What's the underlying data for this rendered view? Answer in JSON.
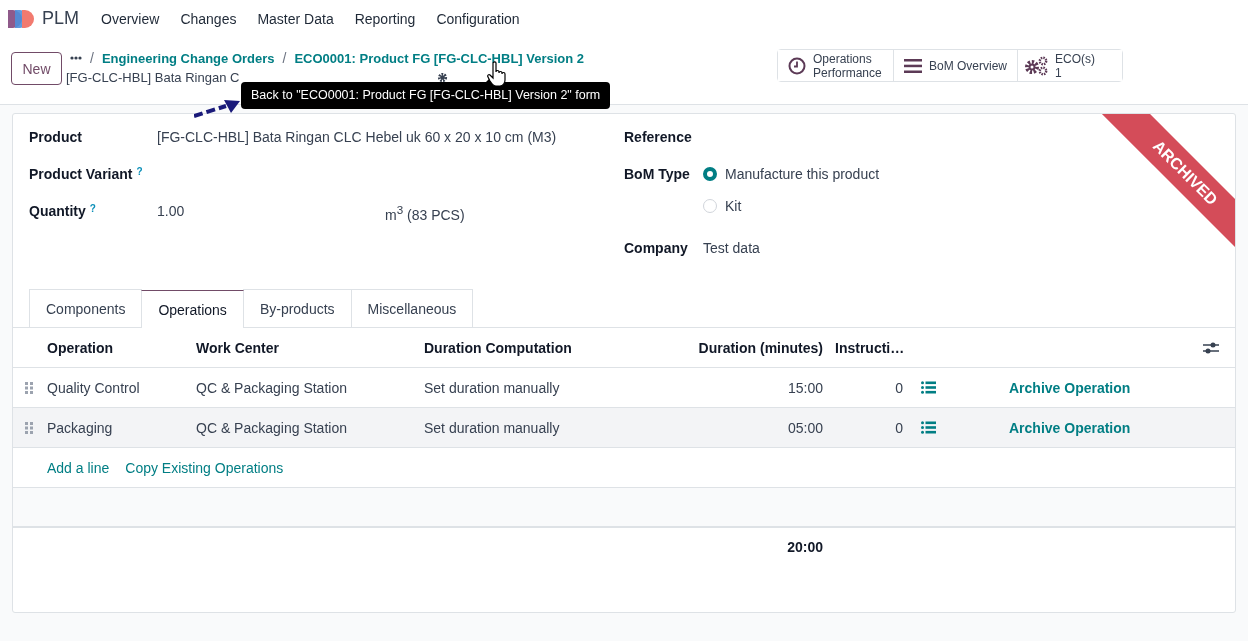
{
  "app": {
    "name": "PLM"
  },
  "menu": [
    {
      "label": "Overview"
    },
    {
      "label": "Changes"
    },
    {
      "label": "Master Data"
    },
    {
      "label": "Reporting"
    },
    {
      "label": "Configuration"
    }
  ],
  "control_panel": {
    "new_button": "New",
    "breadcrumbs": [
      {
        "separator": "/",
        "label": "Engineering Change Orders"
      },
      {
        "separator": "/",
        "label": "ECO0001: Product FG [FG-CLC-HBL] Version 2"
      }
    ],
    "record_title": "[FG-CLC-HBL] Bata Ringan C",
    "tooltip": "Back to \"ECO0001: Product FG [FG-CLC-HBL] Version 2\" form",
    "smart_buttons": [
      {
        "kind": "clock",
        "label": "Operations Performance"
      },
      {
        "kind": "list",
        "label": "BoM Overview"
      },
      {
        "kind": "gears",
        "label": "ECO(s)",
        "value": "1"
      }
    ]
  },
  "ribbon": "ARCHIVED",
  "fields_left": [
    {
      "label": "Product",
      "value": "[FG-CLC-HBL] Bata Ringan CLC Hebel uk 60 x 20 x 10 cm (M3)"
    },
    {
      "label": "Product Variant",
      "help": "?"
    },
    {
      "label": "Quantity",
      "help": "?",
      "value": "1.00",
      "unit": "m$^{3}$ (83 PCS)"
    }
  ],
  "fields_right": [
    {
      "label": "Reference"
    },
    {
      "label": "BoM Type",
      "options": [
        {
          "label": "Manufacture this product",
          "selected": true
        },
        {
          "label": "Kit",
          "selected": false
        }
      ]
    },
    {
      "label": "Company",
      "value": "Test data"
    }
  ],
  "tabs": [
    {
      "label": "Components",
      "selected": false
    },
    {
      "label": "Operations",
      "selected": true
    },
    {
      "label": "By-products",
      "selected": false
    },
    {
      "label": "Miscellaneous",
      "selected": false
    }
  ],
  "table": {
    "columns": [
      "Operation",
      "Work Center",
      "Duration Computation",
      "Duration (minutes)",
      "Instructi…"
    ],
    "rows": [
      {
        "operation": "Quality Control",
        "work_center": "QC & Packaging Station",
        "duration_computation": "Set duration manually",
        "duration": "15:00",
        "instructions": "0",
        "action": "Archive Operation",
        "hovered": false
      },
      {
        "operation": "Packaging",
        "work_center": "QC & Packaging Station",
        "duration_computation": "Set duration manually",
        "duration": "05:00",
        "instructions": "0",
        "action": "Archive Operation",
        "hovered": true
      }
    ],
    "add_links": [
      "Add a line",
      "Copy Existing Operations"
    ],
    "total_duration": "20:00"
  }
}
